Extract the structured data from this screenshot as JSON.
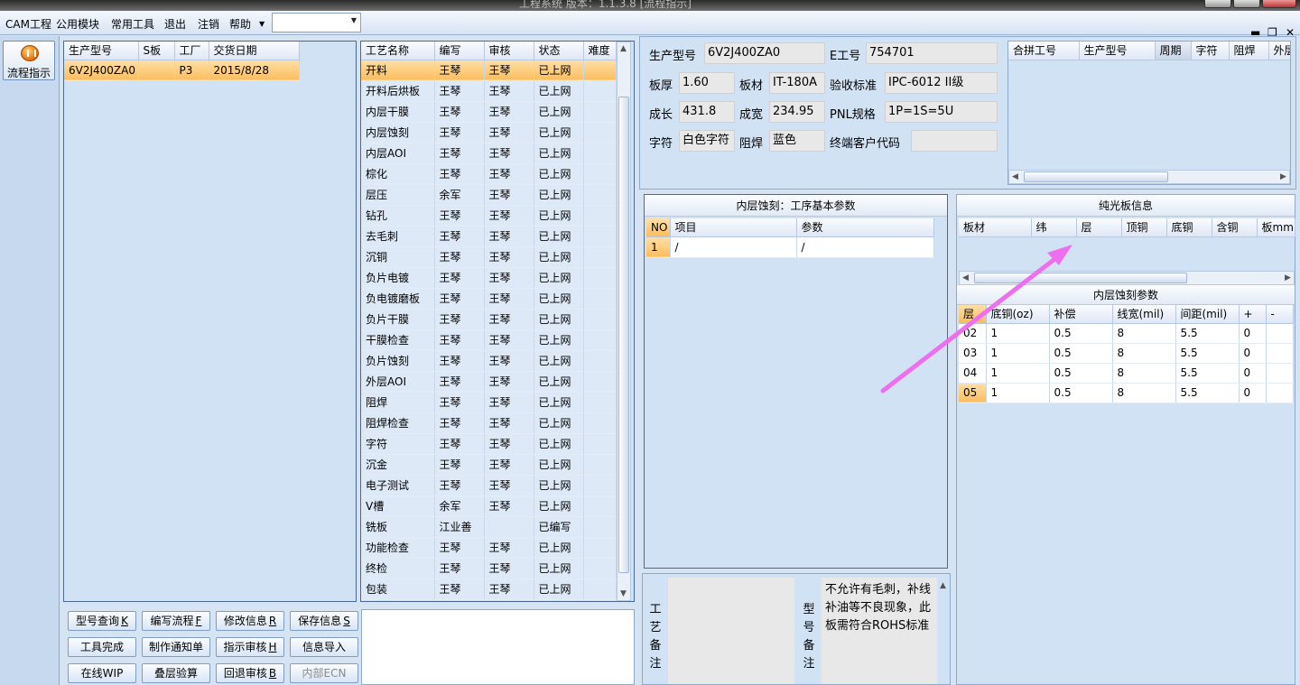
{
  "title": "工程系统  版本：1.1.3.8  [流程指示]",
  "menu": [
    "CAM工程",
    "公用模块",
    "常用工具",
    "退出",
    "注销",
    "帮助"
  ],
  "sidebar": {
    "flow_label": "流程指示"
  },
  "model_table": {
    "headers": [
      "生产型号",
      "S板",
      "工厂",
      "交货日期"
    ],
    "rows": [
      [
        "6V2J400ZA0",
        "",
        "P3",
        "2015/8/28"
      ]
    ]
  },
  "process_table": {
    "headers": [
      "工艺名称",
      "编写",
      "审核",
      "状态",
      "难度"
    ],
    "rows": [
      [
        "开料",
        "王琴",
        "王琴",
        "已上网",
        ""
      ],
      [
        "开料后烘板",
        "王琴",
        "王琴",
        "已上网",
        ""
      ],
      [
        "内层干膜",
        "王琴",
        "王琴",
        "已上网",
        ""
      ],
      [
        "内层蚀刻",
        "王琴",
        "王琴",
        "已上网",
        ""
      ],
      [
        "内层AOI",
        "王琴",
        "王琴",
        "已上网",
        ""
      ],
      [
        "棕化",
        "王琴",
        "王琴",
        "已上网",
        ""
      ],
      [
        "层压",
        "余军",
        "王琴",
        "已上网",
        ""
      ],
      [
        "钻孔",
        "王琴",
        "王琴",
        "已上网",
        ""
      ],
      [
        "去毛刺",
        "王琴",
        "王琴",
        "已上网",
        ""
      ],
      [
        "沉铜",
        "王琴",
        "王琴",
        "已上网",
        ""
      ],
      [
        "负片电镀",
        "王琴",
        "王琴",
        "已上网",
        ""
      ],
      [
        "负电镀磨板",
        "王琴",
        "王琴",
        "已上网",
        ""
      ],
      [
        "负片干膜",
        "王琴",
        "王琴",
        "已上网",
        ""
      ],
      [
        "干膜检查",
        "王琴",
        "王琴",
        "已上网",
        ""
      ],
      [
        "负片蚀刻",
        "王琴",
        "王琴",
        "已上网",
        ""
      ],
      [
        "外层AOI",
        "王琴",
        "王琴",
        "已上网",
        ""
      ],
      [
        "阻焊",
        "王琴",
        "王琴",
        "已上网",
        ""
      ],
      [
        "阻焊检查",
        "王琴",
        "王琴",
        "已上网",
        ""
      ],
      [
        "字符",
        "王琴",
        "王琴",
        "已上网",
        ""
      ],
      [
        "沉金",
        "王琴",
        "王琴",
        "已上网",
        ""
      ],
      [
        "电子测试",
        "王琴",
        "王琴",
        "已上网",
        ""
      ],
      [
        "V槽",
        "余军",
        "王琴",
        "已上网",
        ""
      ],
      [
        "铣板",
        "江业善",
        "",
        "已编写",
        ""
      ],
      [
        "功能检查",
        "王琴",
        "王琴",
        "已上网",
        ""
      ],
      [
        "终检",
        "王琴",
        "王琴",
        "已上网",
        ""
      ],
      [
        "包装",
        "王琴",
        "王琴",
        "已上网",
        ""
      ]
    ]
  },
  "buttons": [
    {
      "label": "型号查询",
      "key": "K"
    },
    {
      "label": "编写流程",
      "key": "F"
    },
    {
      "label": "修改信息",
      "key": "R"
    },
    {
      "label": "保存信息",
      "key": "S"
    },
    {
      "label": "工具完成",
      "key": ""
    },
    {
      "label": "制作通知单",
      "key": ""
    },
    {
      "label": "指示审核",
      "key": "H"
    },
    {
      "label": "信息导入",
      "key": ""
    },
    {
      "label": "在线WIP",
      "key": ""
    },
    {
      "label": "叠层验算",
      "key": ""
    },
    {
      "label": "回退审核",
      "key": "B"
    },
    {
      "label": "内部ECN",
      "key": ""
    }
  ],
  "info": {
    "model_label": "生产型号",
    "model": "6V2J400ZA0",
    "e_label": "E工号",
    "e_no": "754701",
    "thick_label": "板厚",
    "thick": "1.60",
    "mat_label": "板材",
    "mat": "IT-180A",
    "std_label": "验收标准",
    "std": "IPC-6012 II级",
    "len_label": "成长",
    "len": "431.8",
    "wid_label": "成宽",
    "wid": "234.95",
    "pnl_label": "PNL规格",
    "pnl": "1P=1S=5U",
    "char_label": "字符",
    "char": "白色字符",
    "mask_label": "阻焊",
    "mask": "蓝色",
    "cust_label": "终端客户代码",
    "cust": ""
  },
  "merge_table": {
    "headers": [
      "合拼工号",
      "生产型号",
      "周期",
      "字符",
      "阻焊",
      "外层"
    ]
  },
  "step_params": {
    "title": "内层蚀刻：工序基本参数",
    "headers": [
      "NO",
      "项目",
      "参数"
    ],
    "rows": [
      [
        "1",
        "/",
        "/"
      ]
    ]
  },
  "bare_board": {
    "title": "纯光板信息",
    "headers": [
      "板材",
      "纬",
      "层",
      "顶铜",
      "底铜",
      "含铜",
      "板mm"
    ]
  },
  "etch_params": {
    "title": "内层蚀刻参数",
    "headers": [
      "层",
      "底铜(oz)",
      "补偿",
      "线宽(mil)",
      "间距(mil)",
      "+",
      "-"
    ],
    "rows": [
      [
        "02",
        "1",
        "0.5",
        "8",
        "5.5",
        "0",
        ""
      ],
      [
        "03",
        "1",
        "0.5",
        "8",
        "5.5",
        "0",
        ""
      ],
      [
        "04",
        "1",
        "0.5",
        "8",
        "5.5",
        "0",
        ""
      ],
      [
        "05",
        "1",
        "0.5",
        "8",
        "5.5",
        "0",
        ""
      ]
    ]
  },
  "notes": {
    "process_label": "工艺备注",
    "model_label": "型号备注",
    "model_text": "不允许有毛刺，补线补油等不良现象，此板需符合ROHS标准"
  },
  "colors": {
    "accent": "#fbbd5e",
    "arrow": "#ee6ef0",
    "panel_bg": "#d2e2f5"
  }
}
